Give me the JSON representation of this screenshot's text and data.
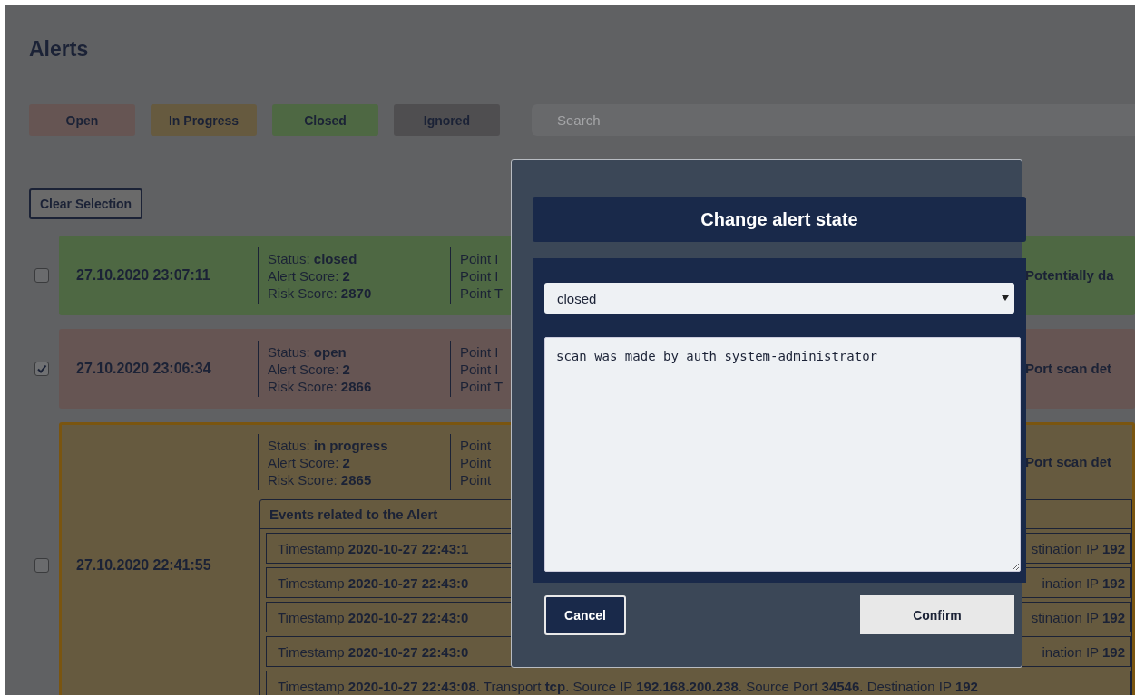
{
  "page": {
    "title": "Alerts"
  },
  "filters": [
    {
      "label": "Open",
      "kind": "open"
    },
    {
      "label": "In Progress",
      "kind": "in_progress"
    },
    {
      "label": "Closed",
      "kind": "closed"
    },
    {
      "label": "Ignored",
      "kind": "ignored"
    }
  ],
  "search": {
    "placeholder": "Search"
  },
  "clear_button": "Clear Selection",
  "alerts": [
    {
      "checked": false,
      "kind": "closed",
      "expanded": false,
      "time": "27.10.2020 23:07:11",
      "info": [
        "Status: **closed**",
        "Alert Score: **2**",
        "Risk Score: **2870**"
      ],
      "points": [
        "Point I",
        "Point I",
        "Point T"
      ],
      "title": "Potentially da"
    },
    {
      "checked": true,
      "kind": "open",
      "expanded": false,
      "time": "27.10.2020 23:06:34",
      "info": [
        "Status: **open**",
        "Alert Score: **2**",
        "Risk Score: **2866**"
      ],
      "points": [
        "Point I",
        "Point I",
        "Point T"
      ],
      "title": "Port scan det"
    },
    {
      "checked": false,
      "kind": "in_progress",
      "expanded": true,
      "time": "27.10.2020 22:41:55",
      "info": [
        "Status: **in progress**",
        "Alert Score: **2**",
        "Risk Score: **2865**"
      ],
      "points": [
        "Point",
        "Point",
        "Point"
      ],
      "title": "Port scan det",
      "events_title": "Events related to the Alert",
      "events": [
        {
          "kind": "split",
          "left": "Timestamp **2020-10-27 22:43:1**",
          "right": "stination IP **192**"
        },
        {
          "kind": "split",
          "left": "Timestamp **2020-10-27 22:43:0**",
          "right": "ination IP **192**"
        },
        {
          "kind": "split",
          "left": "Timestamp **2020-10-27 22:43:0**",
          "right": "stination IP **192**"
        },
        {
          "kind": "split",
          "left": "Timestamp **2020-10-27 22:43:0**",
          "right": "ination IP **192**"
        },
        {
          "kind": "full",
          "text": "Timestamp **2020-10-27 22:43:08**. Transport **tcp**. Source IP **192.168.200.238**. Source Port **34546**. Destination IP **192**"
        }
      ]
    }
  ],
  "modal": {
    "title": "Change alert state",
    "state": "closed",
    "comment": "scan was made by auth system-administrator",
    "cancel": "Cancel",
    "confirm": "Confirm"
  }
}
